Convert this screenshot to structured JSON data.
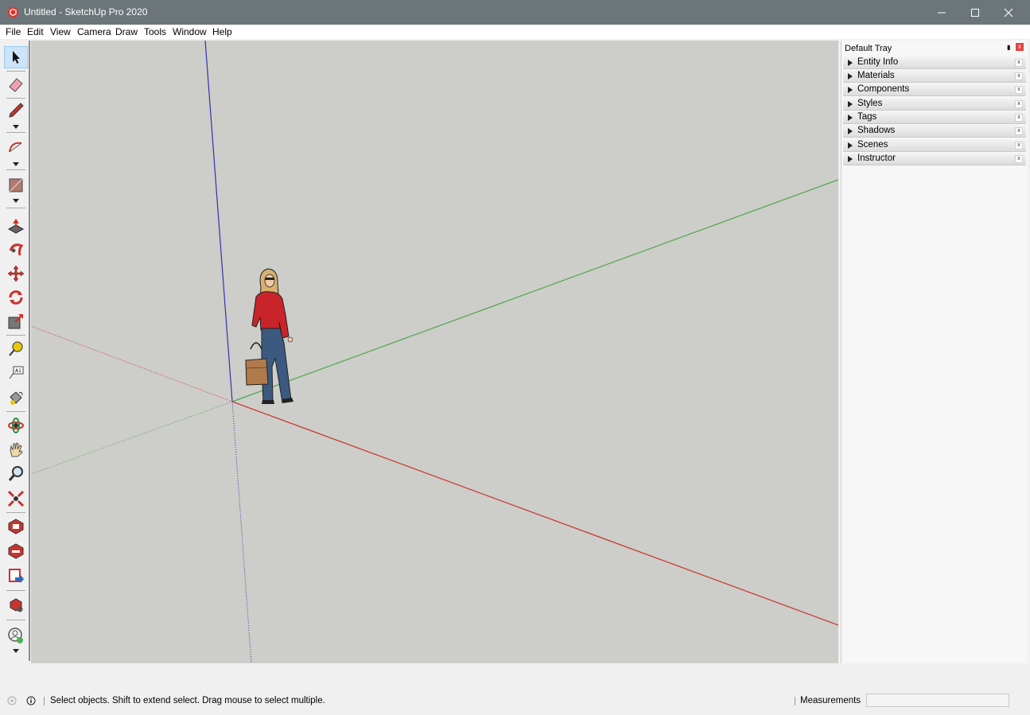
{
  "window": {
    "title": "Untitled - SketchUp Pro 2020",
    "titlebar_color": "#6c767a",
    "minimize_icon": "minimize-icon",
    "maximize_icon": "maximize-icon",
    "close_icon": "close-icon"
  },
  "menubar": {
    "items": [
      "File",
      "Edit",
      "View",
      "Camera",
      "Draw",
      "Tools",
      "Window",
      "Help"
    ]
  },
  "toolbar": {
    "tools": [
      "select-icon",
      "eraser-icon",
      "line-pencil-icon",
      "arc-icon",
      "rectangle-icon",
      "push-pull-icon",
      "follow-me-icon",
      "move-icon",
      "rotate-icon",
      "scale-icon",
      "tape-measure-icon",
      "text-icon",
      "paint-bucket-icon",
      "orbit-icon",
      "pan-icon",
      "zoom-icon",
      "zoom-extents-icon",
      "3d-warehouse-icon",
      "extension-warehouse-icon",
      "layout-send-icon",
      "extension-manager-icon",
      "account-icon"
    ],
    "active_tool": "select-icon"
  },
  "viewport": {
    "background": "#cdcdc9",
    "axis_colors": {
      "red": "#c8342e",
      "green": "#4aa84a",
      "blue": "#3232b4"
    }
  },
  "tray": {
    "title": "Default Tray",
    "panels": [
      "Entity Info",
      "Materials",
      "Components",
      "Styles",
      "Tags",
      "Shadows",
      "Scenes",
      "Instructor"
    ]
  },
  "statusbar": {
    "status_text": "Select objects. Shift to extend select. Drag mouse to select multiple.",
    "measurements_label": "Measurements",
    "measurements_value": ""
  }
}
